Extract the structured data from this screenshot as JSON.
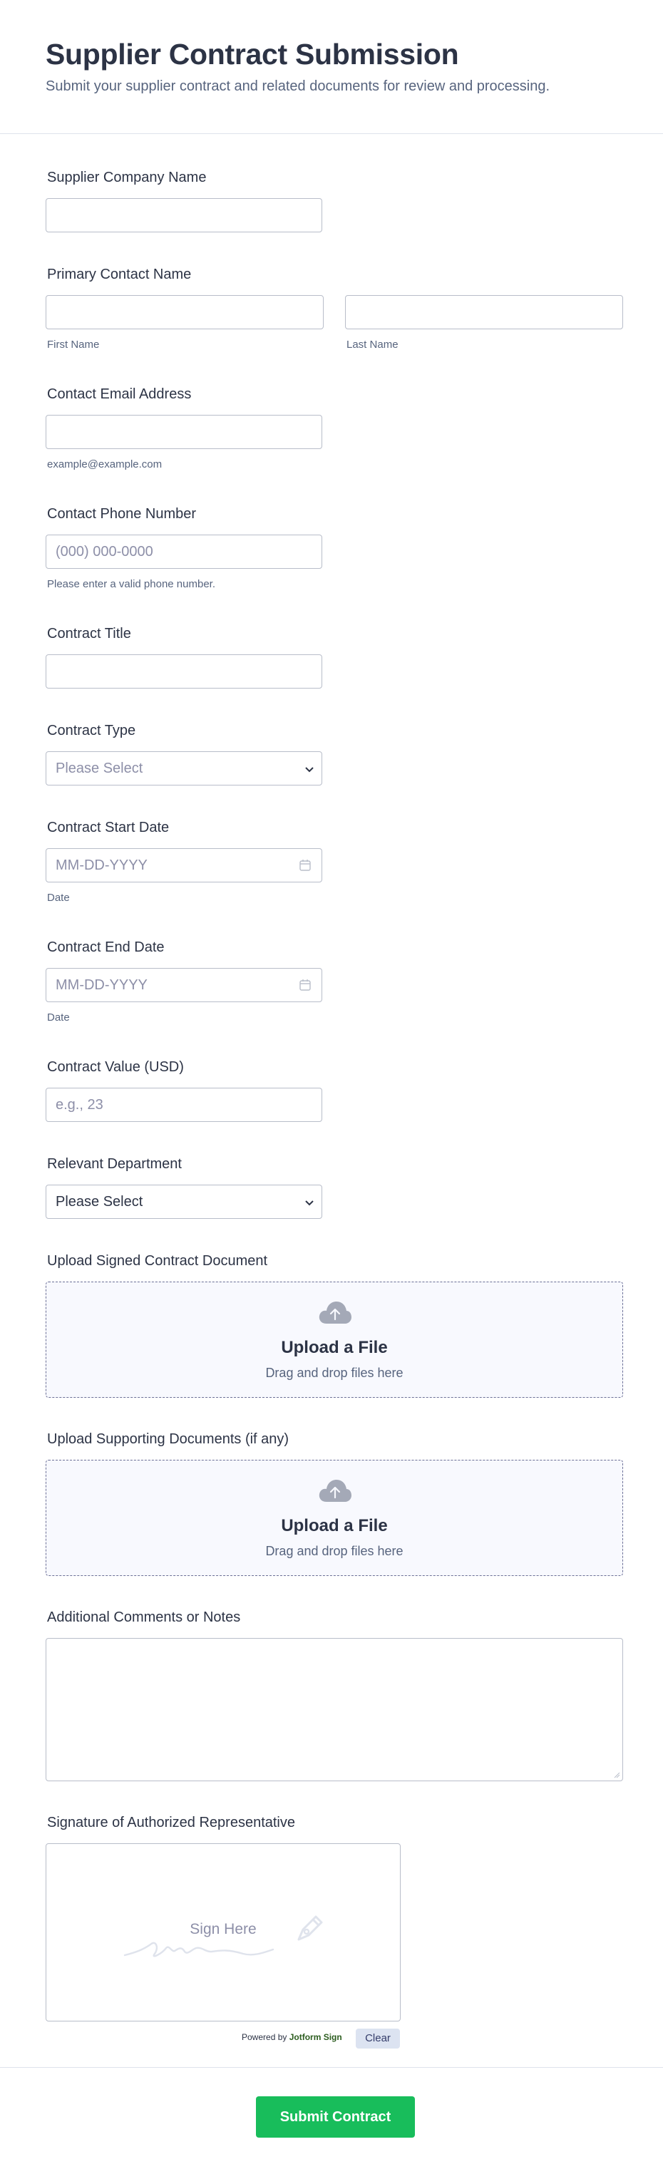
{
  "header": {
    "title": "Supplier Contract Submission",
    "subtitle": "Submit your supplier contract and related documents for review and processing."
  },
  "fields": {
    "company": {
      "label": "Supplier Company Name"
    },
    "contact": {
      "label": "Primary Contact Name",
      "first_sub": "First Name",
      "last_sub": "Last Name"
    },
    "email": {
      "label": "Contact Email Address",
      "sub": "example@example.com"
    },
    "phone": {
      "label": "Contact Phone Number",
      "placeholder": "(000) 000-0000",
      "sub": "Please enter a valid phone number."
    },
    "title": {
      "label": "Contract Title"
    },
    "type": {
      "label": "Contract Type",
      "placeholder": "Please Select"
    },
    "start": {
      "label": "Contract Start Date",
      "placeholder": "MM-DD-YYYY",
      "sub": "Date"
    },
    "end": {
      "label": "Contract End Date",
      "placeholder": "MM-DD-YYYY",
      "sub": "Date"
    },
    "value": {
      "label": "Contract Value (USD)",
      "placeholder": "e.g., 23"
    },
    "department": {
      "label": "Relevant Department",
      "value": "Please Select"
    },
    "signed_doc": {
      "label": "Upload Signed Contract Document",
      "upload_title": "Upload a File",
      "upload_sub": "Drag and drop files here"
    },
    "supporting": {
      "label": "Upload Supporting Documents (if any)",
      "upload_title": "Upload a File",
      "upload_sub": "Drag and drop files here"
    },
    "comments": {
      "label": "Additional Comments or Notes"
    },
    "signature": {
      "label": "Signature of Authorized Representative",
      "placeholder": "Sign Here",
      "powered": "Powered by ",
      "brand": "Jotform Sign",
      "clear": "Clear"
    }
  },
  "submit": {
    "label": "Submit Contract"
  },
  "colors": {
    "accent": "#18bd5b",
    "border": "#b8bdc9",
    "text": "#2c3345",
    "muted": "#57647e"
  },
  "icons": [
    "chevron-down-icon",
    "calendar-icon",
    "cloud-upload-icon",
    "pen-nib-icon",
    "resize-handle-icon"
  ]
}
